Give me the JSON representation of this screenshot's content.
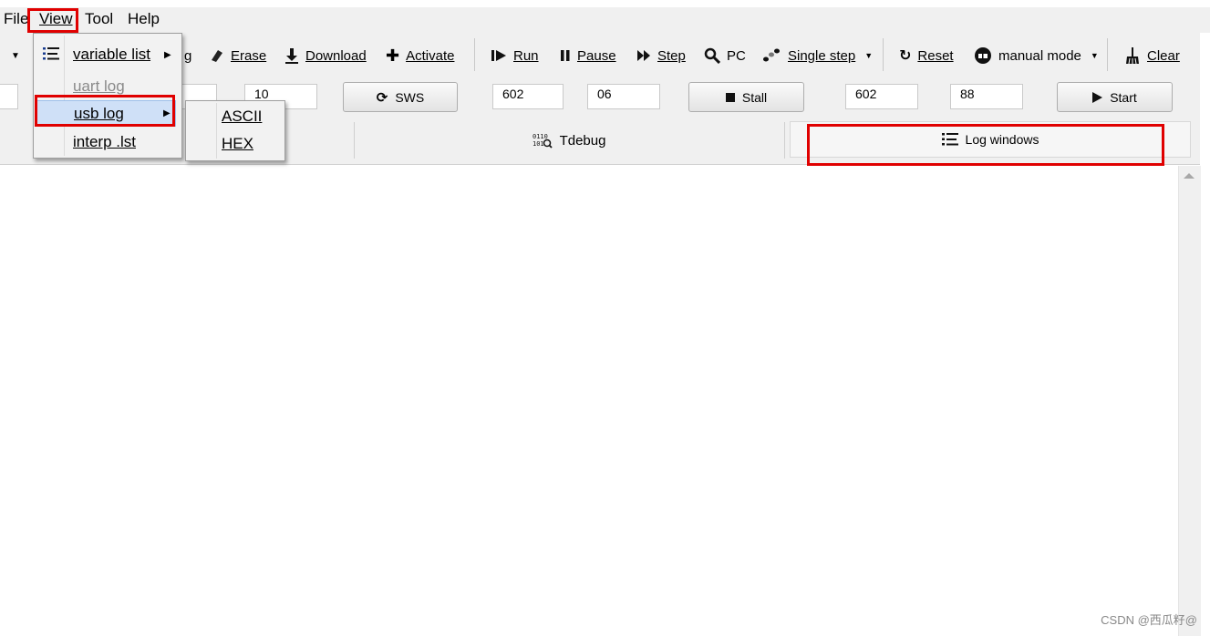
{
  "menubar": {
    "file": "File",
    "view": "View",
    "tool": "Tool",
    "help": "Help"
  },
  "toolbar": {
    "partial_left": "g",
    "erase": "Erase",
    "download": "Download",
    "activate": "Activate",
    "run": "Run",
    "pause": "Pause",
    "step": "Step",
    "pc": "PC",
    "single_step": "Single step",
    "reset": "Reset",
    "manual_mode": "manual mode",
    "clear": "Clear"
  },
  "fields": {
    "f1": "",
    "f2": "",
    "f3": "10",
    "f4": "602",
    "f5": "06",
    "f6": "602",
    "f7": "88"
  },
  "buttons": {
    "sws": "SWS",
    "stall": "Stall",
    "start": "Start"
  },
  "tabs": {
    "tdebug": "Tdebug",
    "log_windows": "Log windows"
  },
  "view_menu": {
    "items": [
      "variable list",
      "uart log",
      "usb log",
      "interp .lst"
    ]
  },
  "usb_submenu": {
    "items": [
      "ASCII",
      "HEX"
    ]
  },
  "watermark": "CSDN @西瓜籽@",
  "colors": {
    "highlight": "#e00000",
    "selected_item": "#cfe0f7"
  }
}
